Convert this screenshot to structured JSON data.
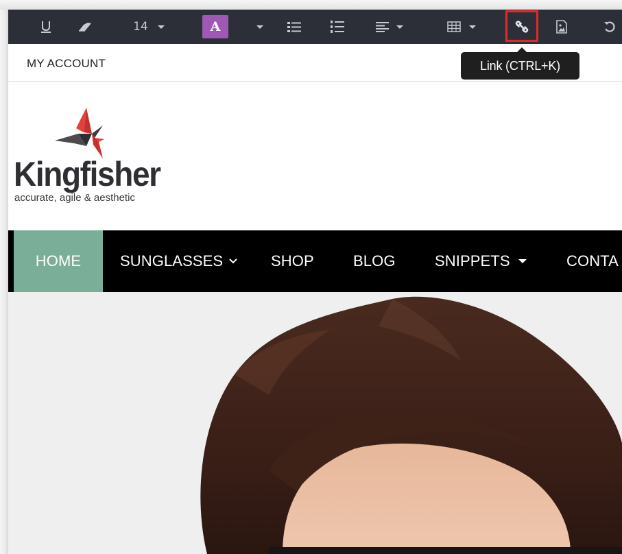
{
  "toolbar": {
    "font_size": "14",
    "color_letter": "A",
    "accent_color": "#a058b6",
    "icons": [
      "underline-icon",
      "eraser-icon",
      "color-icon",
      "unordered-list-icon",
      "ordered-list-icon",
      "align-icon",
      "table-icon",
      "link-icon",
      "picture-icon",
      "undo-icon"
    ]
  },
  "tooltip": {
    "text": "Link (CTRL+K)"
  },
  "topbar": {
    "account_label": "MY ACCOUNT"
  },
  "logo": {
    "word": "Kingfisher",
    "tagline": "accurate, agile & aesthetic"
  },
  "nav": {
    "active_color": "#7bae98",
    "items": [
      {
        "label": "HOME"
      },
      {
        "label": "SUNGLASSES"
      },
      {
        "label": "SHOP"
      },
      {
        "label": "BLOG"
      },
      {
        "label": "SNIPPETS"
      },
      {
        "label": "CONTA"
      }
    ]
  }
}
